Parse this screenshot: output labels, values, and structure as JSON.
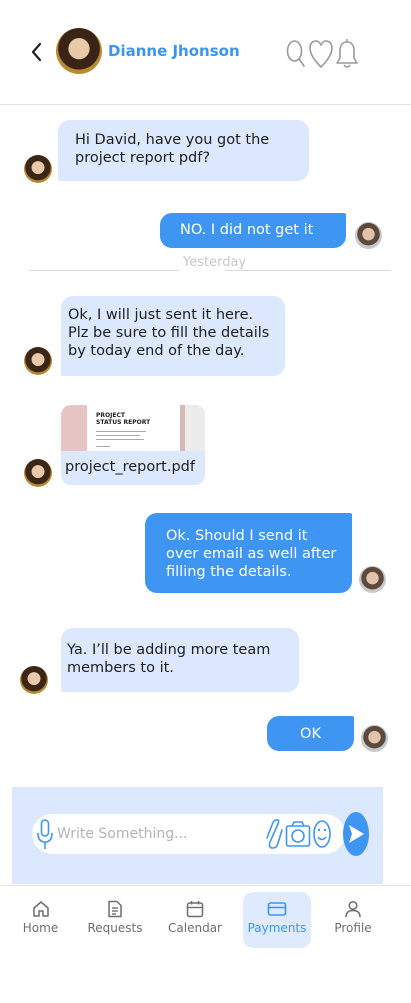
{
  "header": {
    "contact_name": "Dianne Jhonson",
    "icons": [
      "back-chevron-icon",
      "search-icon",
      "heart-icon",
      "bell-icon"
    ]
  },
  "messages": [
    {
      "from": "her",
      "text": "Hi David, have you got the project report pdf?"
    },
    {
      "from": "him",
      "text": "NO. I did not get it"
    },
    {
      "from": "her",
      "text": "Ok, I will just sent it here. Plz be sure to fill the details by today end of the day."
    },
    {
      "from": "her",
      "type": "file",
      "file_name": "project_report.pdf",
      "thumb_title_line1": "PROJECT",
      "thumb_title_line2": "STATUS REPORT"
    },
    {
      "from": "him",
      "text": "Ok. Should I send it over email as well after filling the details."
    },
    {
      "from": "her",
      "text": "Ya. I’ll be adding more team members to it."
    },
    {
      "from": "him",
      "text": "OK"
    }
  ],
  "date_separator": "Yesterday",
  "composer": {
    "placeholder": "Write Something...",
    "icons": [
      "microphone-icon",
      "paperclip-icon",
      "camera-icon",
      "emoji-icon",
      "send-icon"
    ]
  },
  "nav": {
    "items": [
      {
        "label": "Home",
        "icon": "home-icon"
      },
      {
        "label": "Requests",
        "icon": "document-icon"
      },
      {
        "label": "Calendar",
        "icon": "calendar-icon"
      },
      {
        "label": "Payments",
        "icon": "card-icon",
        "active": true
      },
      {
        "label": "Profile",
        "icon": "user-icon"
      }
    ]
  },
  "colors": {
    "accent": "#3e96f2",
    "incoming_bubble": "#dbe8fe",
    "composer_bg": "#dbe8fe",
    "nav_active_bg": "#dfeafe"
  }
}
